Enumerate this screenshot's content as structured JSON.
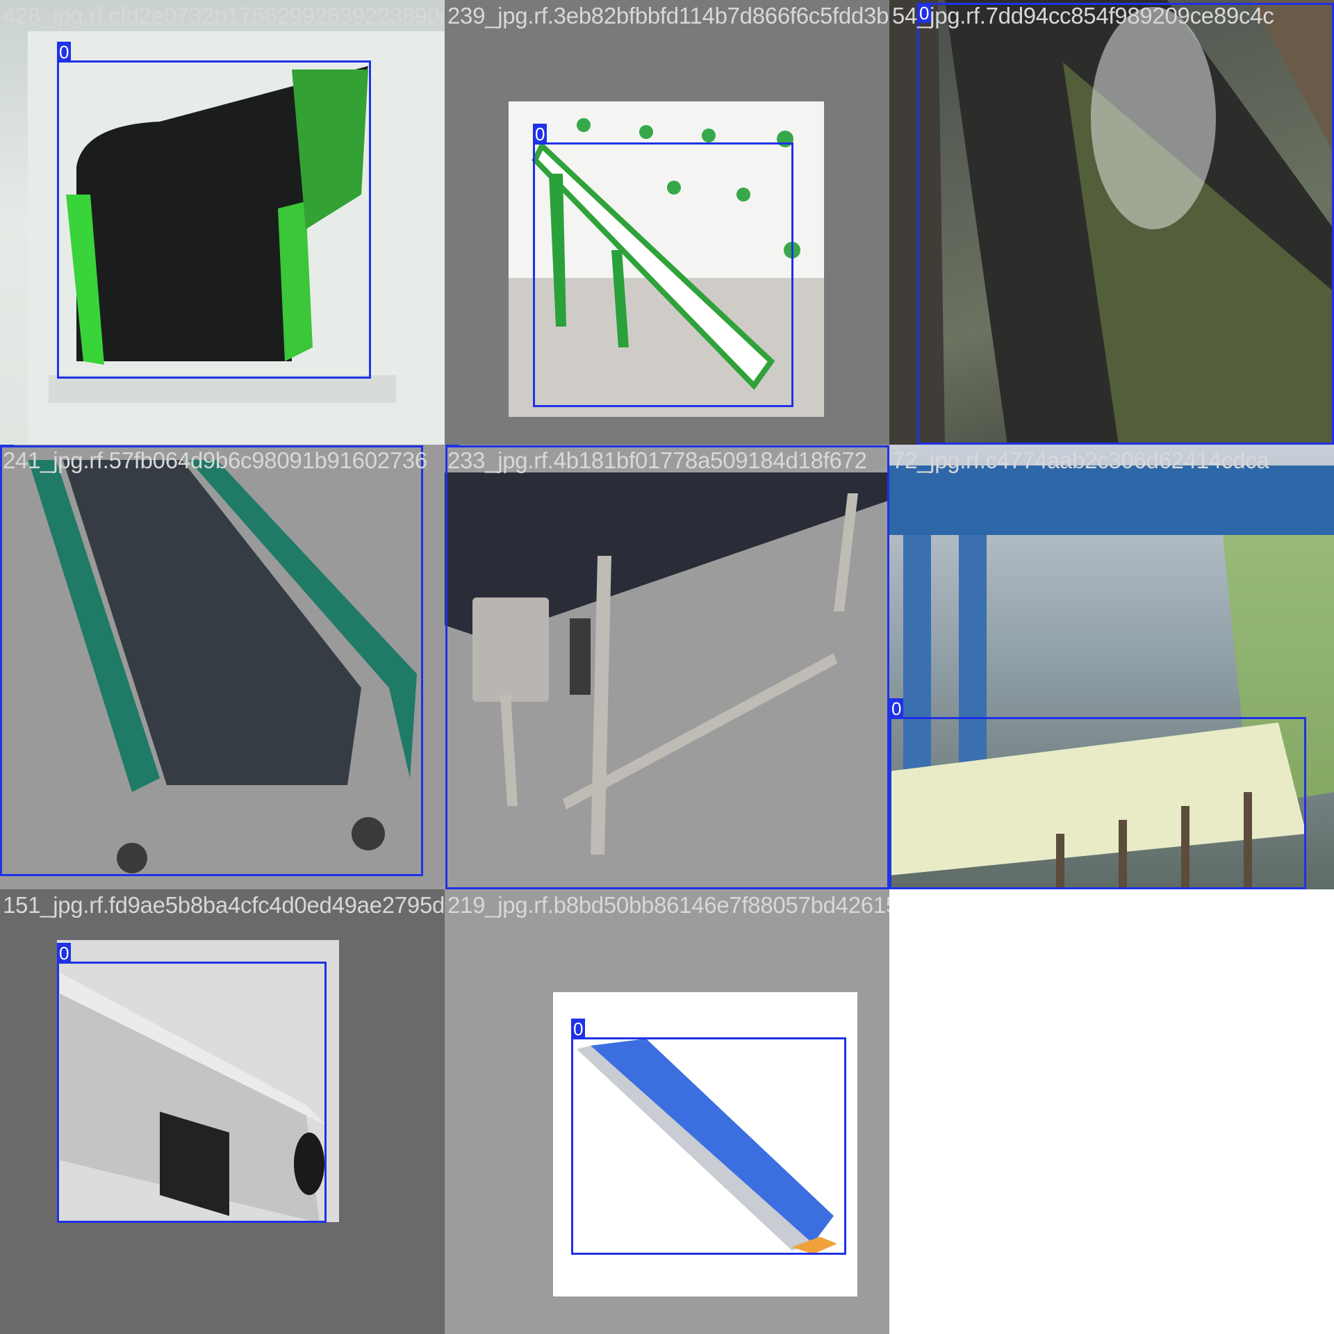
{
  "tiles": [
    {
      "filename": "428_jpg.rf.cfd2e0732b17562992639223890d3",
      "label": "0"
    },
    {
      "filename": "239_jpg.rf.3eb82bfbbfd114b7d866f6c5fdd3b5",
      "label": "0"
    },
    {
      "filename": "54_jpg.rf.7dd94cc854f989209ce89c4c",
      "label": "0"
    },
    {
      "filename": "241_jpg.rf.57fb064d9b6c98091b91602736",
      "label": "0"
    },
    {
      "filename": "233_jpg.rf.4b181bf01778a509184d18f672",
      "label": "0"
    },
    {
      "filename": "72_jpg.rf.c4774aab2c306d62414cdca",
      "label": "0"
    },
    {
      "filename": "151_jpg.rf.fd9ae5b8ba4cfc4d0ed49ae2795d",
      "label": "0"
    },
    {
      "filename": "219_jpg.rf.b8bd50bb86146e7f88057bd42615a",
      "label": ""
    }
  ],
  "colors": {
    "bbox": "#1f32e6",
    "filename_text": "#d8d8d8",
    "background": "#ffffff"
  }
}
